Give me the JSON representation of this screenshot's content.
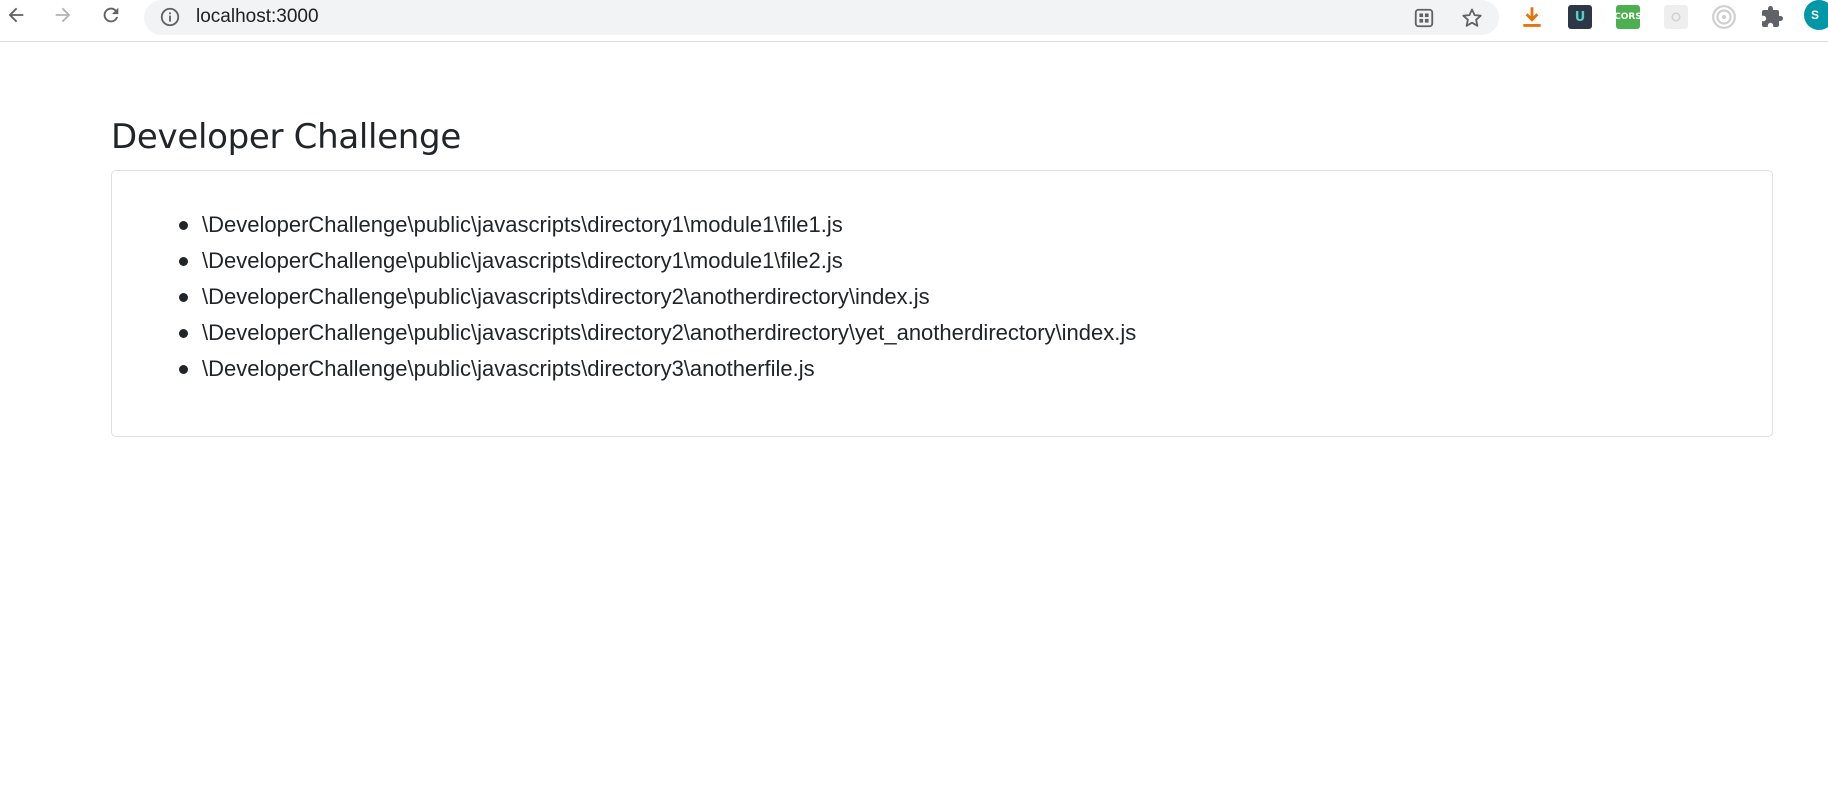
{
  "browser": {
    "url": "localhost:3000",
    "avatar_letter": "S",
    "extensions": [
      {
        "name": "download-icon",
        "color": "#e8710a"
      },
      {
        "name": "u-extension-icon",
        "label": "U",
        "color": "#2d3748"
      },
      {
        "name": "cors-extension-icon",
        "label": "CORS",
        "color": "#4caf50"
      },
      {
        "name": "flower-extension-icon",
        "color": "#e0e0e0"
      },
      {
        "name": "target-extension-icon",
        "color": "#bdbdbd"
      },
      {
        "name": "puzzle-icon",
        "color": "#5f6368"
      }
    ]
  },
  "page": {
    "title": "Developer Challenge",
    "files": [
      "\\DeveloperChallenge\\public\\javascripts\\directory1\\module1\\file1.js",
      "\\DeveloperChallenge\\public\\javascripts\\directory1\\module1\\file2.js",
      "\\DeveloperChallenge\\public\\javascripts\\directory2\\anotherdirectory\\index.js",
      "\\DeveloperChallenge\\public\\javascripts\\directory2\\anotherdirectory\\yet_anotherdirectory\\index.js",
      "\\DeveloperChallenge\\public\\javascripts\\directory3\\anotherfile.js"
    ]
  }
}
